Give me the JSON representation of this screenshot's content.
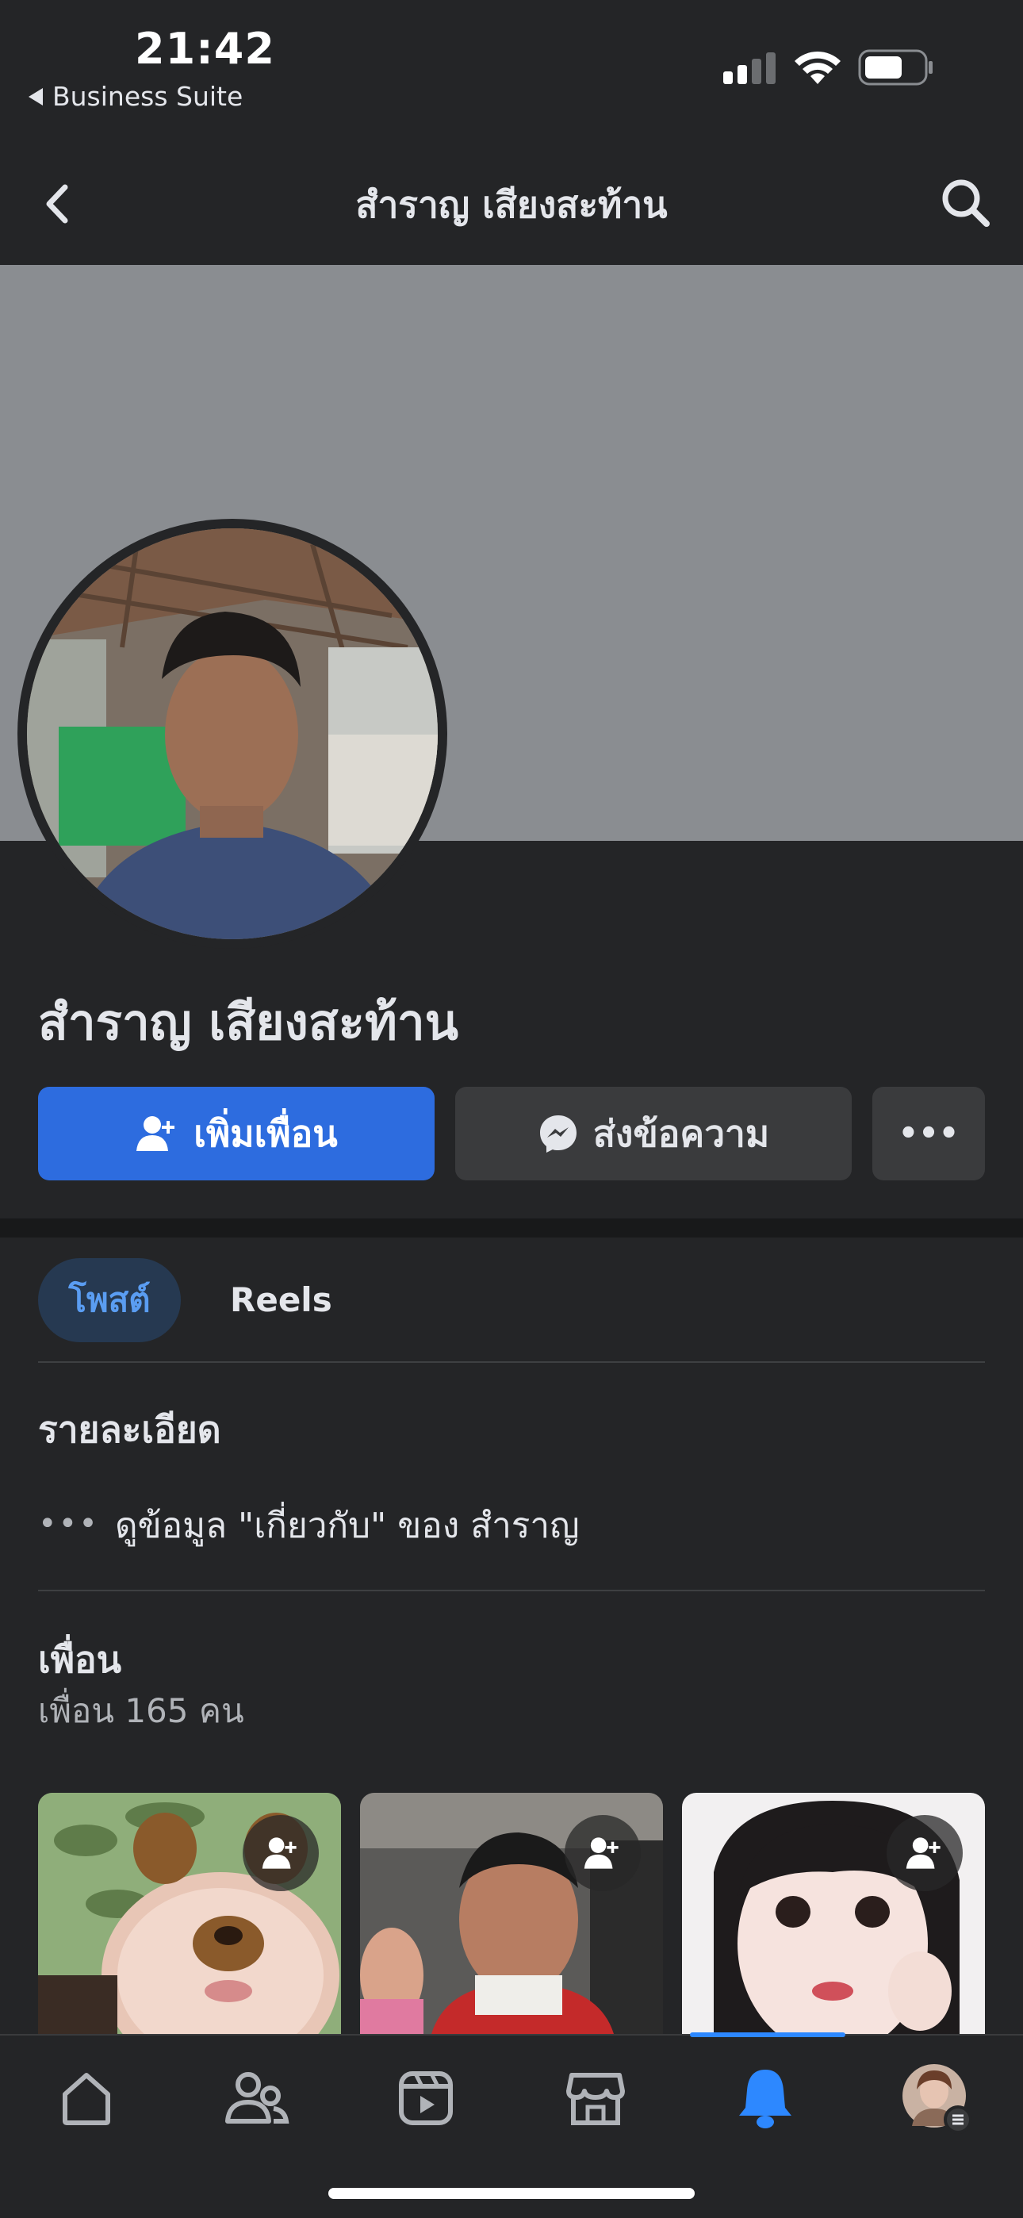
{
  "status": {
    "time": "21:42",
    "back_app": "Business Suite"
  },
  "nav": {
    "title": "สำราญ เสียงสะท้าน"
  },
  "profile": {
    "name": "สำราญ เสียงสะท้าน"
  },
  "actions": {
    "add_friend": "เพิ่มเพื่อน",
    "message": "ส่งข้อความ",
    "more": "•••"
  },
  "tabs": [
    {
      "label": "โพสต์",
      "active": true
    },
    {
      "label": "Reels",
      "active": false
    }
  ],
  "details": {
    "title": "รายละเอียด",
    "dots": "•••",
    "about_link": "ดูข้อมูล \"เกี่ยวกับ\" ของ สำราญ"
  },
  "friends": {
    "title": "เพื่อน",
    "count_text": "เพื่อน 165 คน"
  },
  "bottom_tabs": [
    "home-icon",
    "friends-icon",
    "video-icon",
    "marketplace-icon",
    "notifications-icon",
    "profile-avatar"
  ],
  "colors": {
    "accent": "#2d6cdf",
    "active_tab": "#2d88ff",
    "background": "#242527",
    "cover": "#8a8d91"
  }
}
